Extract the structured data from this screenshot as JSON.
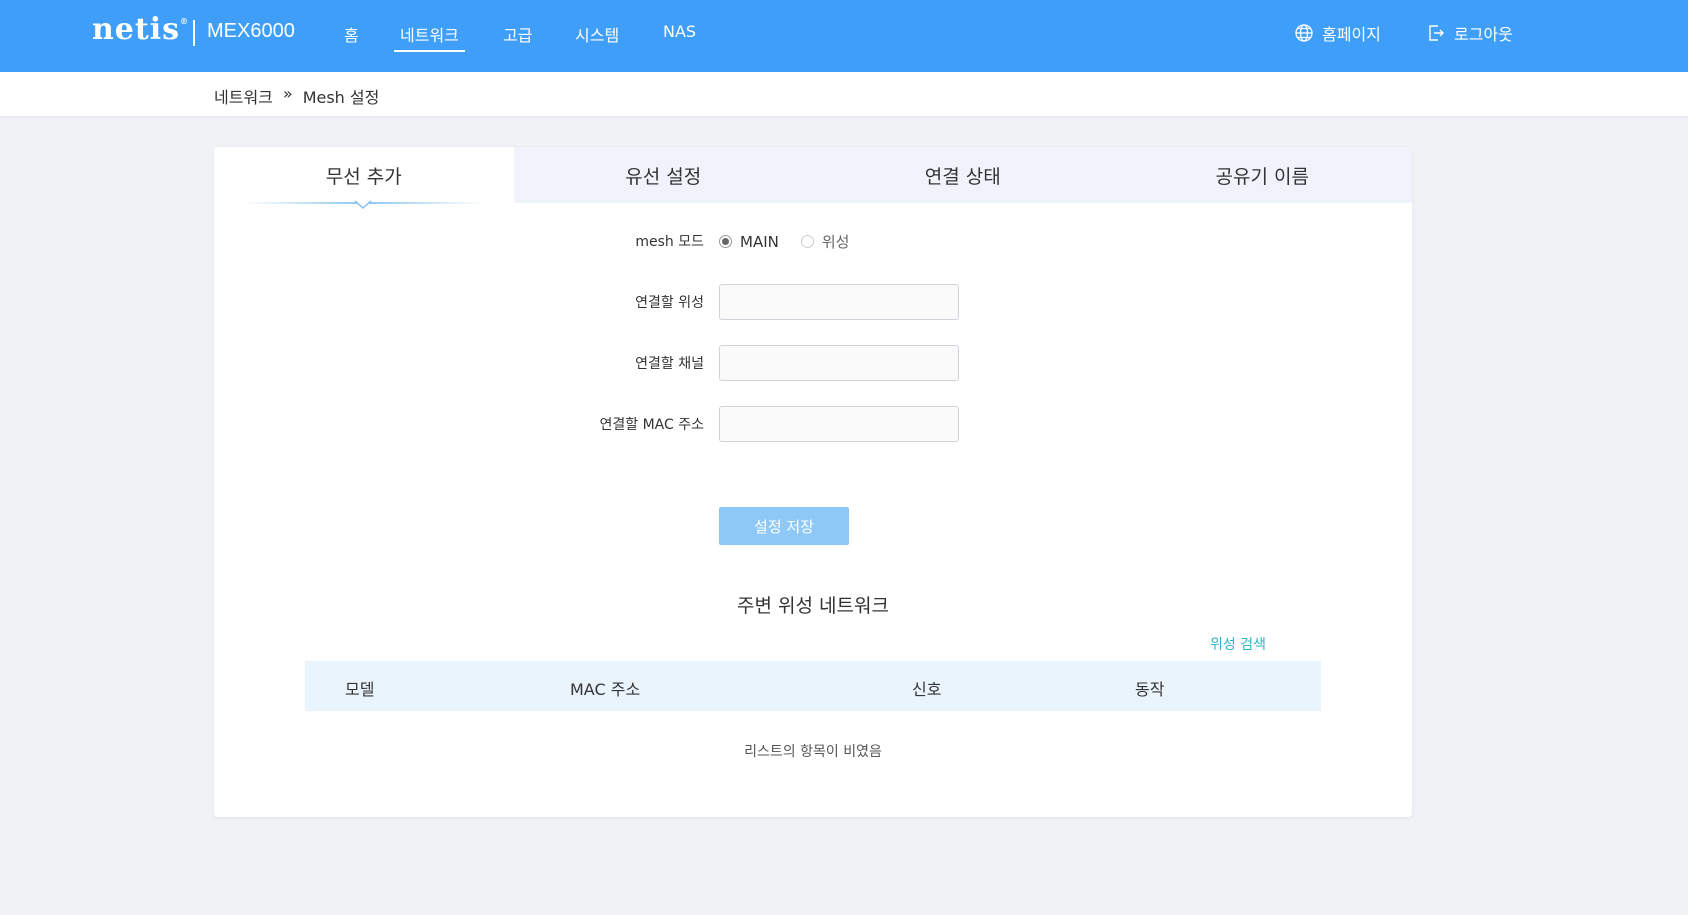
{
  "header": {
    "logo": "netis",
    "logo_mark": "®",
    "model": "MEX6000",
    "nav": [
      {
        "label": "홈",
        "active": false
      },
      {
        "label": "네트워크",
        "active": true
      },
      {
        "label": "고급",
        "active": false
      },
      {
        "label": "시스템",
        "active": false
      },
      {
        "label": "NAS",
        "active": false
      }
    ],
    "homepage_label": "홈페이지",
    "logout_label": "로그아웃",
    "homepage_icon": "globe-icon",
    "logout_icon": "logout-icon",
    "bg_color": "#3f9ff8"
  },
  "breadcrumb": {
    "parent": "네트워크",
    "separator": "»",
    "current": "Mesh 설정"
  },
  "tabs": [
    {
      "label": "무선 추가",
      "active": true
    },
    {
      "label": "유선 설정",
      "active": false
    },
    {
      "label": "연결 상태",
      "active": false
    },
    {
      "label": "공유기 이름",
      "active": false
    }
  ],
  "form": {
    "mesh_mode_label": "mesh 모드",
    "mode_main": "MAIN",
    "mode_satellite": "위성",
    "selected_mode": "MAIN",
    "satellite_label": "연결할 위성",
    "satellite_value": "",
    "channel_label": "연결할 채널",
    "channel_value": "",
    "mac_label": "연결할 MAC 주소",
    "mac_value": "",
    "save_label": "설정 저장"
  },
  "nearby": {
    "title": "주변 위성 네트워크",
    "search_label": "위성 검색",
    "columns": [
      "모델",
      "MAC 주소",
      "신호",
      "동작"
    ],
    "rows": [],
    "empty_message": "리스트의 항목이 비였음"
  },
  "colors": {
    "accent": "#3f9ff8",
    "button": "#8ec8f6",
    "link": "#2cb5c9",
    "table_head": "#eaf4fd"
  }
}
